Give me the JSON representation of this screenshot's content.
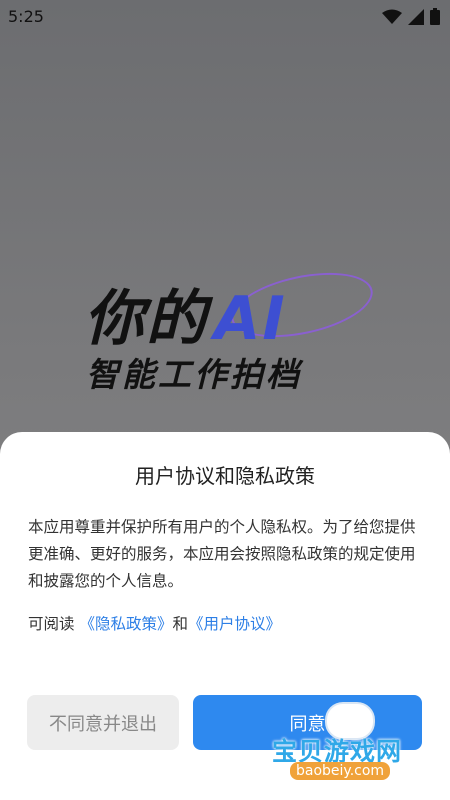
{
  "status_bar": {
    "time": "5:25",
    "wifi_icon": "wifi-icon",
    "signal_icon": "signal-icon",
    "battery_icon": "battery-icon"
  },
  "hero": {
    "line1": "你的",
    "ai": "AI",
    "line2": "智能工作拍档"
  },
  "dialog": {
    "title": "用户协议和隐私政策",
    "body": "本应用尊重并保护所有用户的个人隐私权。为了给您提供更准确、更好的服务，本应用会按照隐私政策的规定使用和披露您的个人信息。",
    "read_prefix": "可阅读",
    "privacy_link": "《隐私政策》",
    "and": "和",
    "user_link": "《用户协议》",
    "disagree_label": "不同意并退出",
    "agree_label": "同意"
  },
  "watermark": {
    "title": "宝贝游戏网",
    "domain": "baobeiy.com"
  },
  "colors": {
    "accent": "#2e89ef",
    "link": "#2d7fe6",
    "disabled_bg": "#ededed"
  }
}
